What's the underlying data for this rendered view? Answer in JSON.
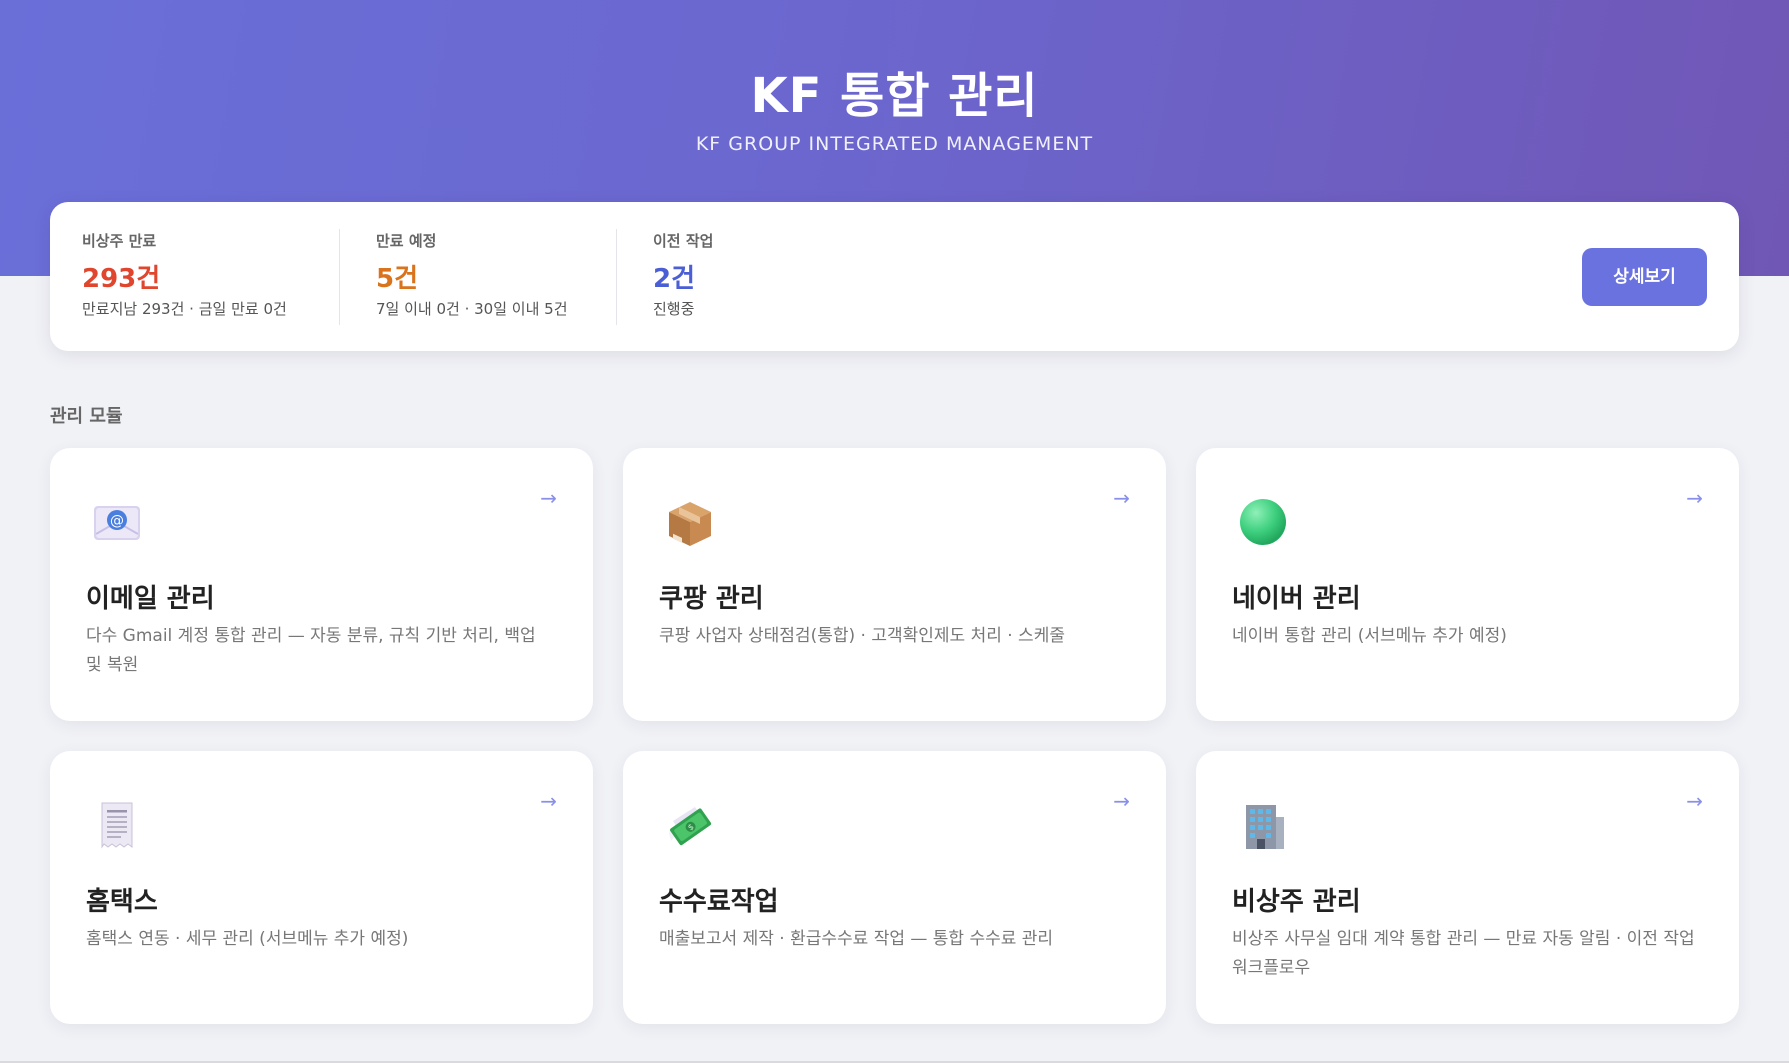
{
  "header": {
    "title": "KF 통합 관리",
    "subtitle": "KF GROUP INTEGRATED MANAGEMENT"
  },
  "stats": [
    {
      "label": "비상주 만료",
      "value": "293건",
      "detail": "만료지남 293건 · 금일 만료 0건",
      "color": "#e0452e"
    },
    {
      "label": "만료 예정",
      "value": "5건",
      "detail": "7일 이내 0건 · 30일 이내 5건",
      "color": "#d9731c"
    },
    {
      "label": "이전 작업",
      "value": "2건",
      "detail": "진행중",
      "color": "#4a5fd6"
    }
  ],
  "detail_button": "상세보기",
  "section_title": "관리 모듈",
  "arrow": "→",
  "modules": [
    {
      "icon": "email-icon",
      "title": "이메일 관리",
      "desc": "다수 Gmail 계정 통합 관리 — 자동 분류, 규칙 기반 처리, 백업 및 복원"
    },
    {
      "icon": "package-icon",
      "title": "쿠팡 관리",
      "desc": "쿠팡 사업자 상태점검(통합) · 고객확인제도 처리 · 스케줄"
    },
    {
      "icon": "green-circle-icon",
      "title": "네이버 관리",
      "desc": "네이버 통합 관리 (서브메뉴 추가 예정)"
    },
    {
      "icon": "receipt-icon",
      "title": "홈택스",
      "desc": "홈택스 연동 · 세무 관리 (서브메뉴 추가 예정)"
    },
    {
      "icon": "money-icon",
      "title": "수수료작업",
      "desc": "매출보고서 제작 · 환급수수료 작업 — 통합 수수료 관리"
    },
    {
      "icon": "building-icon",
      "title": "비상주 관리",
      "desc": "비상주 사무실 임대 계약 통합 관리 — 만료 자동 알림 · 이전 작업 워크플로우"
    }
  ]
}
